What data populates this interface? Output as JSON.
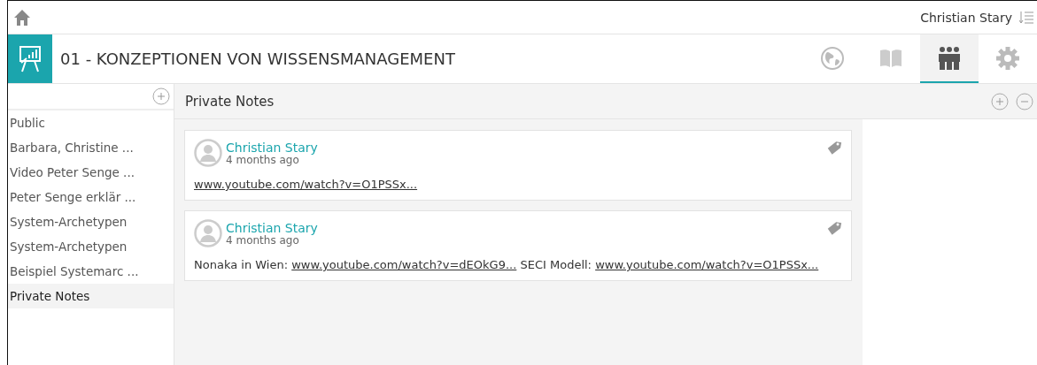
{
  "top_bar": {
    "user": "Christian Stary"
  },
  "header": {
    "title": "01 - KONZEPTIONEN VON WISSENSMANAGEMENT"
  },
  "tabs": [
    {
      "kind": "globe",
      "selected": false
    },
    {
      "kind": "book",
      "selected": false
    },
    {
      "kind": "people",
      "selected": true
    },
    {
      "kind": "gear",
      "selected": false
    }
  ],
  "sidebar": {
    "items": [
      {
        "label": "Public",
        "selected": false
      },
      {
        "label": "Barbara, Christine ...",
        "selected": false
      },
      {
        "label": "Video Peter Senge ...",
        "selected": false
      },
      {
        "label": "Peter Senge erklär ...",
        "selected": false
      },
      {
        "label": "System-Archetypen",
        "selected": false
      },
      {
        "label": "System-Archetypen",
        "selected": false
      },
      {
        "label": "Beispiel Systemarc ...",
        "selected": false
      },
      {
        "label": "Private Notes",
        "selected": true
      }
    ]
  },
  "panel": {
    "title": "Private Notes"
  },
  "notes": [
    {
      "author": "Christian Stary",
      "time": "4 months ago",
      "body": [
        {
          "kind": "link",
          "text": "www.youtube.com/watch?v=O1PSSx..."
        }
      ]
    },
    {
      "author": "Christian Stary",
      "time": "4 months ago",
      "body": [
        {
          "kind": "text",
          "text": "Nonaka in Wien: "
        },
        {
          "kind": "link",
          "text": "www.youtube.com/watch?v=dEOkG9..."
        },
        {
          "kind": "text",
          "text": " SECI Modell: "
        },
        {
          "kind": "link",
          "text": "www.youtube.com/watch?v=O1PSSx..."
        }
      ]
    }
  ]
}
